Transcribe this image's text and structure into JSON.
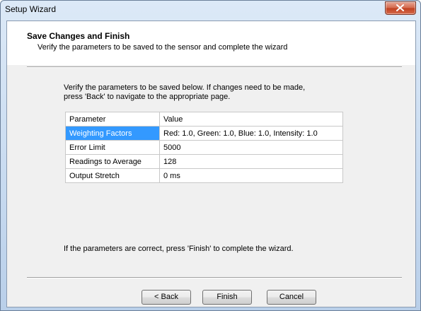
{
  "window": {
    "title": "Setup Wizard"
  },
  "header": {
    "title": "Save Changes and Finish",
    "subtitle": "Verify the parameters to be saved to the sensor and complete the wizard"
  },
  "instructions": {
    "line1": "Verify the parameters to be saved below. If changes need to be made,",
    "line2": "press 'Back' to navigate to the appropriate page."
  },
  "table": {
    "columns": [
      "Parameter",
      "Value"
    ],
    "rows": [
      {
        "parameter": "Weighting Factors",
        "value": "Red: 1.0, Green: 1.0, Blue: 1.0, Intensity: 1.0",
        "selected": true
      },
      {
        "parameter": "Error Limit",
        "value": "5000"
      },
      {
        "parameter": "Readings to Average",
        "value": "128"
      },
      {
        "parameter": "Output Stretch",
        "value": "0 ms"
      }
    ]
  },
  "footer_text": "If the parameters are correct, press 'Finish' to complete the wizard.",
  "buttons": {
    "back": "< Back",
    "finish": "Finish",
    "cancel": "Cancel"
  },
  "colors": {
    "selection": "#3399ff",
    "close_button": "#c7442b"
  },
  "icons": {
    "close": "close-icon"
  }
}
